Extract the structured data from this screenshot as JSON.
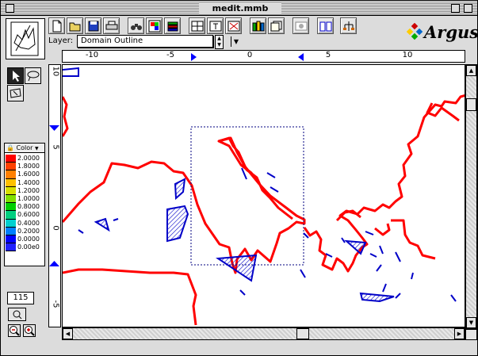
{
  "window": {
    "title": "medit.mmb"
  },
  "toolbar": {
    "buttons": [
      {
        "name": "new-file-icon"
      },
      {
        "name": "open-folder-icon"
      },
      {
        "name": "save-disk-icon"
      },
      {
        "name": "print-icon"
      },
      {
        "name": "binoculars-icon"
      },
      {
        "name": "color-palette-icon"
      },
      {
        "name": "layers-stack-icon"
      },
      {
        "name": "grid-icon"
      },
      {
        "name": "text-box-icon"
      },
      {
        "name": "cross-grid-icon"
      },
      {
        "name": "books-icon"
      },
      {
        "name": "document-stack-icon"
      },
      {
        "name": "globe-card-icon"
      },
      {
        "name": "open-book-icon"
      },
      {
        "name": "tree-icon"
      }
    ]
  },
  "layer": {
    "label": "Layer:",
    "value": "Domain Outline"
  },
  "logo": {
    "text": "Argus"
  },
  "legend": {
    "mode": "Color",
    "entries": [
      {
        "value": "2.0000",
        "color": "#ff0000"
      },
      {
        "value": "1.8000",
        "color": "#ff4000"
      },
      {
        "value": "1.6000",
        "color": "#ff8000"
      },
      {
        "value": "1.4000",
        "color": "#ffc000"
      },
      {
        "value": "1.2000",
        "color": "#d8e000"
      },
      {
        "value": "1.0000",
        "color": "#80e000"
      },
      {
        "value": "0.8000",
        "color": "#00d000"
      },
      {
        "value": "0.6000",
        "color": "#00d080"
      },
      {
        "value": "0.4000",
        "color": "#00d0d0"
      },
      {
        "value": "0.2000",
        "color": "#0080ff"
      },
      {
        "value": "0.0000",
        "color": "#0000ff"
      },
      {
        "value": "0.00e0",
        "color": "#2020ff"
      }
    ]
  },
  "zoom": {
    "value": "115"
  },
  "rulers": {
    "h_ticks": [
      "-10",
      "-5",
      "0",
      "5",
      "10"
    ],
    "v_ticks": [
      "10",
      "5",
      "0",
      "-5"
    ]
  },
  "colors": {
    "coast": "#ff0000",
    "shape": "#0000c8",
    "accent": "#0000ff"
  }
}
